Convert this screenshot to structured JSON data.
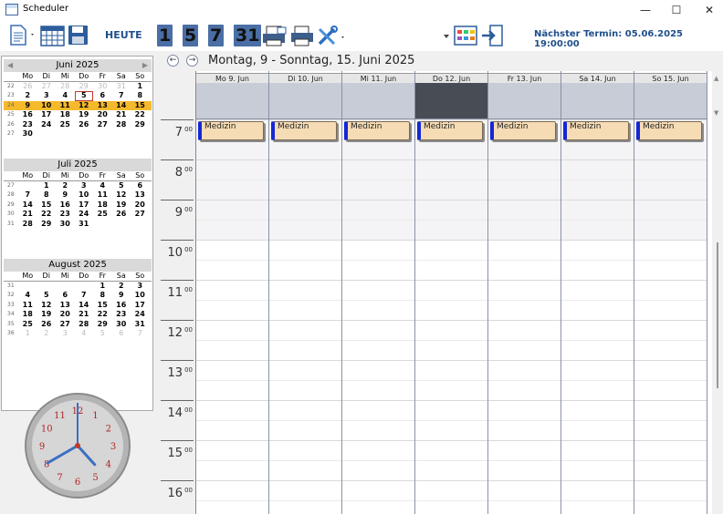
{
  "window": {
    "title": "Scheduler",
    "minimize": "—",
    "maximize": "☐",
    "close": "✕"
  },
  "toolbar": {
    "today_label": "HEUTE",
    "day_views": [
      "1",
      "5",
      "7",
      "31"
    ],
    "next_appointment": "Nächster Termin: 05.06.2025 19:00:00"
  },
  "mini_calendars": [
    {
      "month": "Juni 2025",
      "weekdays": [
        "Mo",
        "Di",
        "Mi",
        "Do",
        "Fr",
        "Sa",
        "So"
      ],
      "weeks": [
        {
          "wk": "22",
          "days": [
            "26",
            "27",
            "28",
            "29",
            "30",
            "31",
            "1"
          ],
          "other": [
            0,
            1,
            2,
            3,
            4,
            5
          ]
        },
        {
          "wk": "23",
          "days": [
            "2",
            "3",
            "4",
            "5",
            "6",
            "7",
            "8"
          ],
          "today": 3
        },
        {
          "wk": "24",
          "days": [
            "9",
            "10",
            "11",
            "12",
            "13",
            "14",
            "15"
          ],
          "selected": true
        },
        {
          "wk": "25",
          "days": [
            "16",
            "17",
            "18",
            "19",
            "20",
            "21",
            "22"
          ]
        },
        {
          "wk": "26",
          "days": [
            "23",
            "24",
            "25",
            "26",
            "27",
            "28",
            "29"
          ]
        },
        {
          "wk": "27",
          "days": [
            "30",
            "",
            "",
            "",
            "",
            "",
            ""
          ]
        }
      ]
    },
    {
      "month": "Juli 2025",
      "weekdays": [
        "Mo",
        "Di",
        "Mi",
        "Do",
        "Fr",
        "Sa",
        "So"
      ],
      "weeks": [
        {
          "wk": "27",
          "days": [
            "",
            "1",
            "2",
            "3",
            "4",
            "5",
            "6"
          ]
        },
        {
          "wk": "28",
          "days": [
            "7",
            "8",
            "9",
            "10",
            "11",
            "12",
            "13"
          ]
        },
        {
          "wk": "29",
          "days": [
            "14",
            "15",
            "16",
            "17",
            "18",
            "19",
            "20"
          ]
        },
        {
          "wk": "30",
          "days": [
            "21",
            "22",
            "23",
            "24",
            "25",
            "26",
            "27"
          ]
        },
        {
          "wk": "31",
          "days": [
            "28",
            "29",
            "30",
            "31",
            "",
            "",
            ""
          ]
        }
      ]
    },
    {
      "month": "August 2025",
      "weekdays": [
        "Mo",
        "Di",
        "Mi",
        "Do",
        "Fr",
        "Sa",
        "So"
      ],
      "weeks": [
        {
          "wk": "31",
          "days": [
            "",
            "",
            "",
            "",
            "1",
            "2",
            "3"
          ]
        },
        {
          "wk": "32",
          "days": [
            "4",
            "5",
            "6",
            "7",
            "8",
            "9",
            "10"
          ]
        },
        {
          "wk": "33",
          "days": [
            "11",
            "12",
            "13",
            "14",
            "15",
            "16",
            "17"
          ]
        },
        {
          "wk": "34",
          "days": [
            "18",
            "19",
            "20",
            "21",
            "22",
            "23",
            "24"
          ]
        },
        {
          "wk": "35",
          "days": [
            "25",
            "26",
            "27",
            "28",
            "29",
            "30",
            "31"
          ]
        },
        {
          "wk": "36",
          "days": [
            "1",
            "2",
            "3",
            "4",
            "5",
            "6",
            "7"
          ],
          "other": [
            0,
            1,
            2,
            3,
            4,
            5,
            6
          ]
        }
      ]
    }
  ],
  "clock": {
    "numbers": [
      "12",
      "1",
      "2",
      "3",
      "4",
      "5",
      "6",
      "7",
      "8",
      "9",
      "10",
      "11"
    ],
    "hour": 4.6,
    "minute": 40
  },
  "week_view": {
    "range_title": "Montag, 9 - Sonntag, 15. Juni 2025",
    "days": [
      {
        "label": "Mo 9. Jun",
        "today": false,
        "appointment": "Medizin"
      },
      {
        "label": "Di 10. Jun",
        "today": false,
        "appointment": "Medizin"
      },
      {
        "label": "Mi 11. Jun",
        "today": false,
        "appointment": "Medizin"
      },
      {
        "label": "Do 12. Jun",
        "today": true,
        "appointment": "Medizin"
      },
      {
        "label": "Fr 13. Jun",
        "today": false,
        "appointment": "Medizin"
      },
      {
        "label": "Sa 14. Jun",
        "today": false,
        "appointment": "Medizin"
      },
      {
        "label": "So 15. Jun",
        "today": false,
        "appointment": "Medizin"
      }
    ],
    "hours": [
      "7",
      "8",
      "9",
      "10",
      "11",
      "12",
      "13",
      "14",
      "15",
      "16"
    ],
    "minute_suffix": "00"
  },
  "colors": {
    "accent": "#1f4e8c",
    "selected_week": "#f5b92c",
    "appointment_fill": "#f6dcb5",
    "appointment_bar": "#1427d6",
    "today_header": "#474c55"
  }
}
